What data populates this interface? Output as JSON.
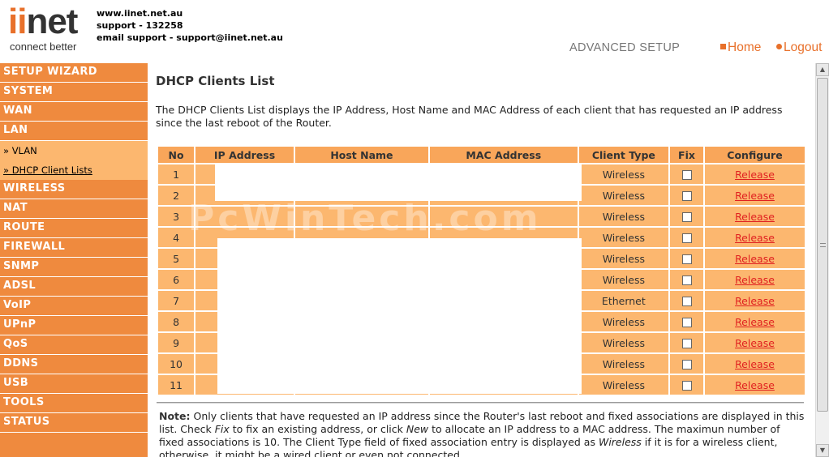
{
  "header": {
    "logo_main_prefix": "ii",
    "logo_main_suffix": "net",
    "logo_tagline": "connect better",
    "contact_lines": [
      "www.iinet.net.au",
      "support - 132258",
      "email support - support@iinet.net.au"
    ],
    "section_title": "ADVANCED SETUP",
    "home_label": "Home",
    "logout_label": "Logout"
  },
  "colors": {
    "accent": "#ef8a3e",
    "row": "#fcb76f",
    "header_row": "#f9a65a",
    "link": "#e02020"
  },
  "sidebar": {
    "items_top": [
      "SETUP WIZARD",
      "SYSTEM",
      "WAN",
      "LAN"
    ],
    "sub_items": [
      "» VLAN",
      "» DHCP Client Lists"
    ],
    "items_bottom": [
      "WIRELESS",
      "NAT",
      "ROUTE",
      "FIREWALL",
      "SNMP",
      "ADSL",
      "VoIP",
      "UPnP",
      "QoS",
      "DDNS",
      "USB",
      "TOOLS",
      "STATUS"
    ]
  },
  "main": {
    "title": "DHCP Clients List",
    "description": "The DHCP Clients List displays the IP Address, Host Name and MAC Address of each client that has requested an IP address since the last reboot of the Router.",
    "table": {
      "columns": [
        "No",
        "IP Address",
        "Host Name",
        "MAC Address",
        "Client Type",
        "Fix",
        "Configure"
      ],
      "release_label": "Release",
      "rows": [
        {
          "no": "1",
          "type": "Wireless"
        },
        {
          "no": "2",
          "type": "Wireless"
        },
        {
          "no": "3",
          "type": "Wireless"
        },
        {
          "no": "4",
          "type": "Wireless"
        },
        {
          "no": "5",
          "type": "Wireless"
        },
        {
          "no": "6",
          "type": "Wireless"
        },
        {
          "no": "7",
          "type": "Ethernet"
        },
        {
          "no": "8",
          "type": "Wireless"
        },
        {
          "no": "9",
          "type": "Wireless"
        },
        {
          "no": "10",
          "type": "Wireless"
        },
        {
          "no": "11",
          "type": "Wireless"
        }
      ]
    },
    "note_label": "Note:",
    "note_parts": [
      " Only clients that have requested an IP address since the Router's last reboot and fixed associations are displayed in this list. Check ",
      "Fix",
      " to fix an existing address, or click ",
      "New",
      " to allocate an IP address to a MAC address. The maximun number of fixed associations is 10. The Client Type field of fixed association entry is displayed as ",
      "Wireless",
      " if it is for a wireless client, otherwise, it might be a wired client or even not connected."
    ],
    "watermark": "PcWinTech.com"
  }
}
